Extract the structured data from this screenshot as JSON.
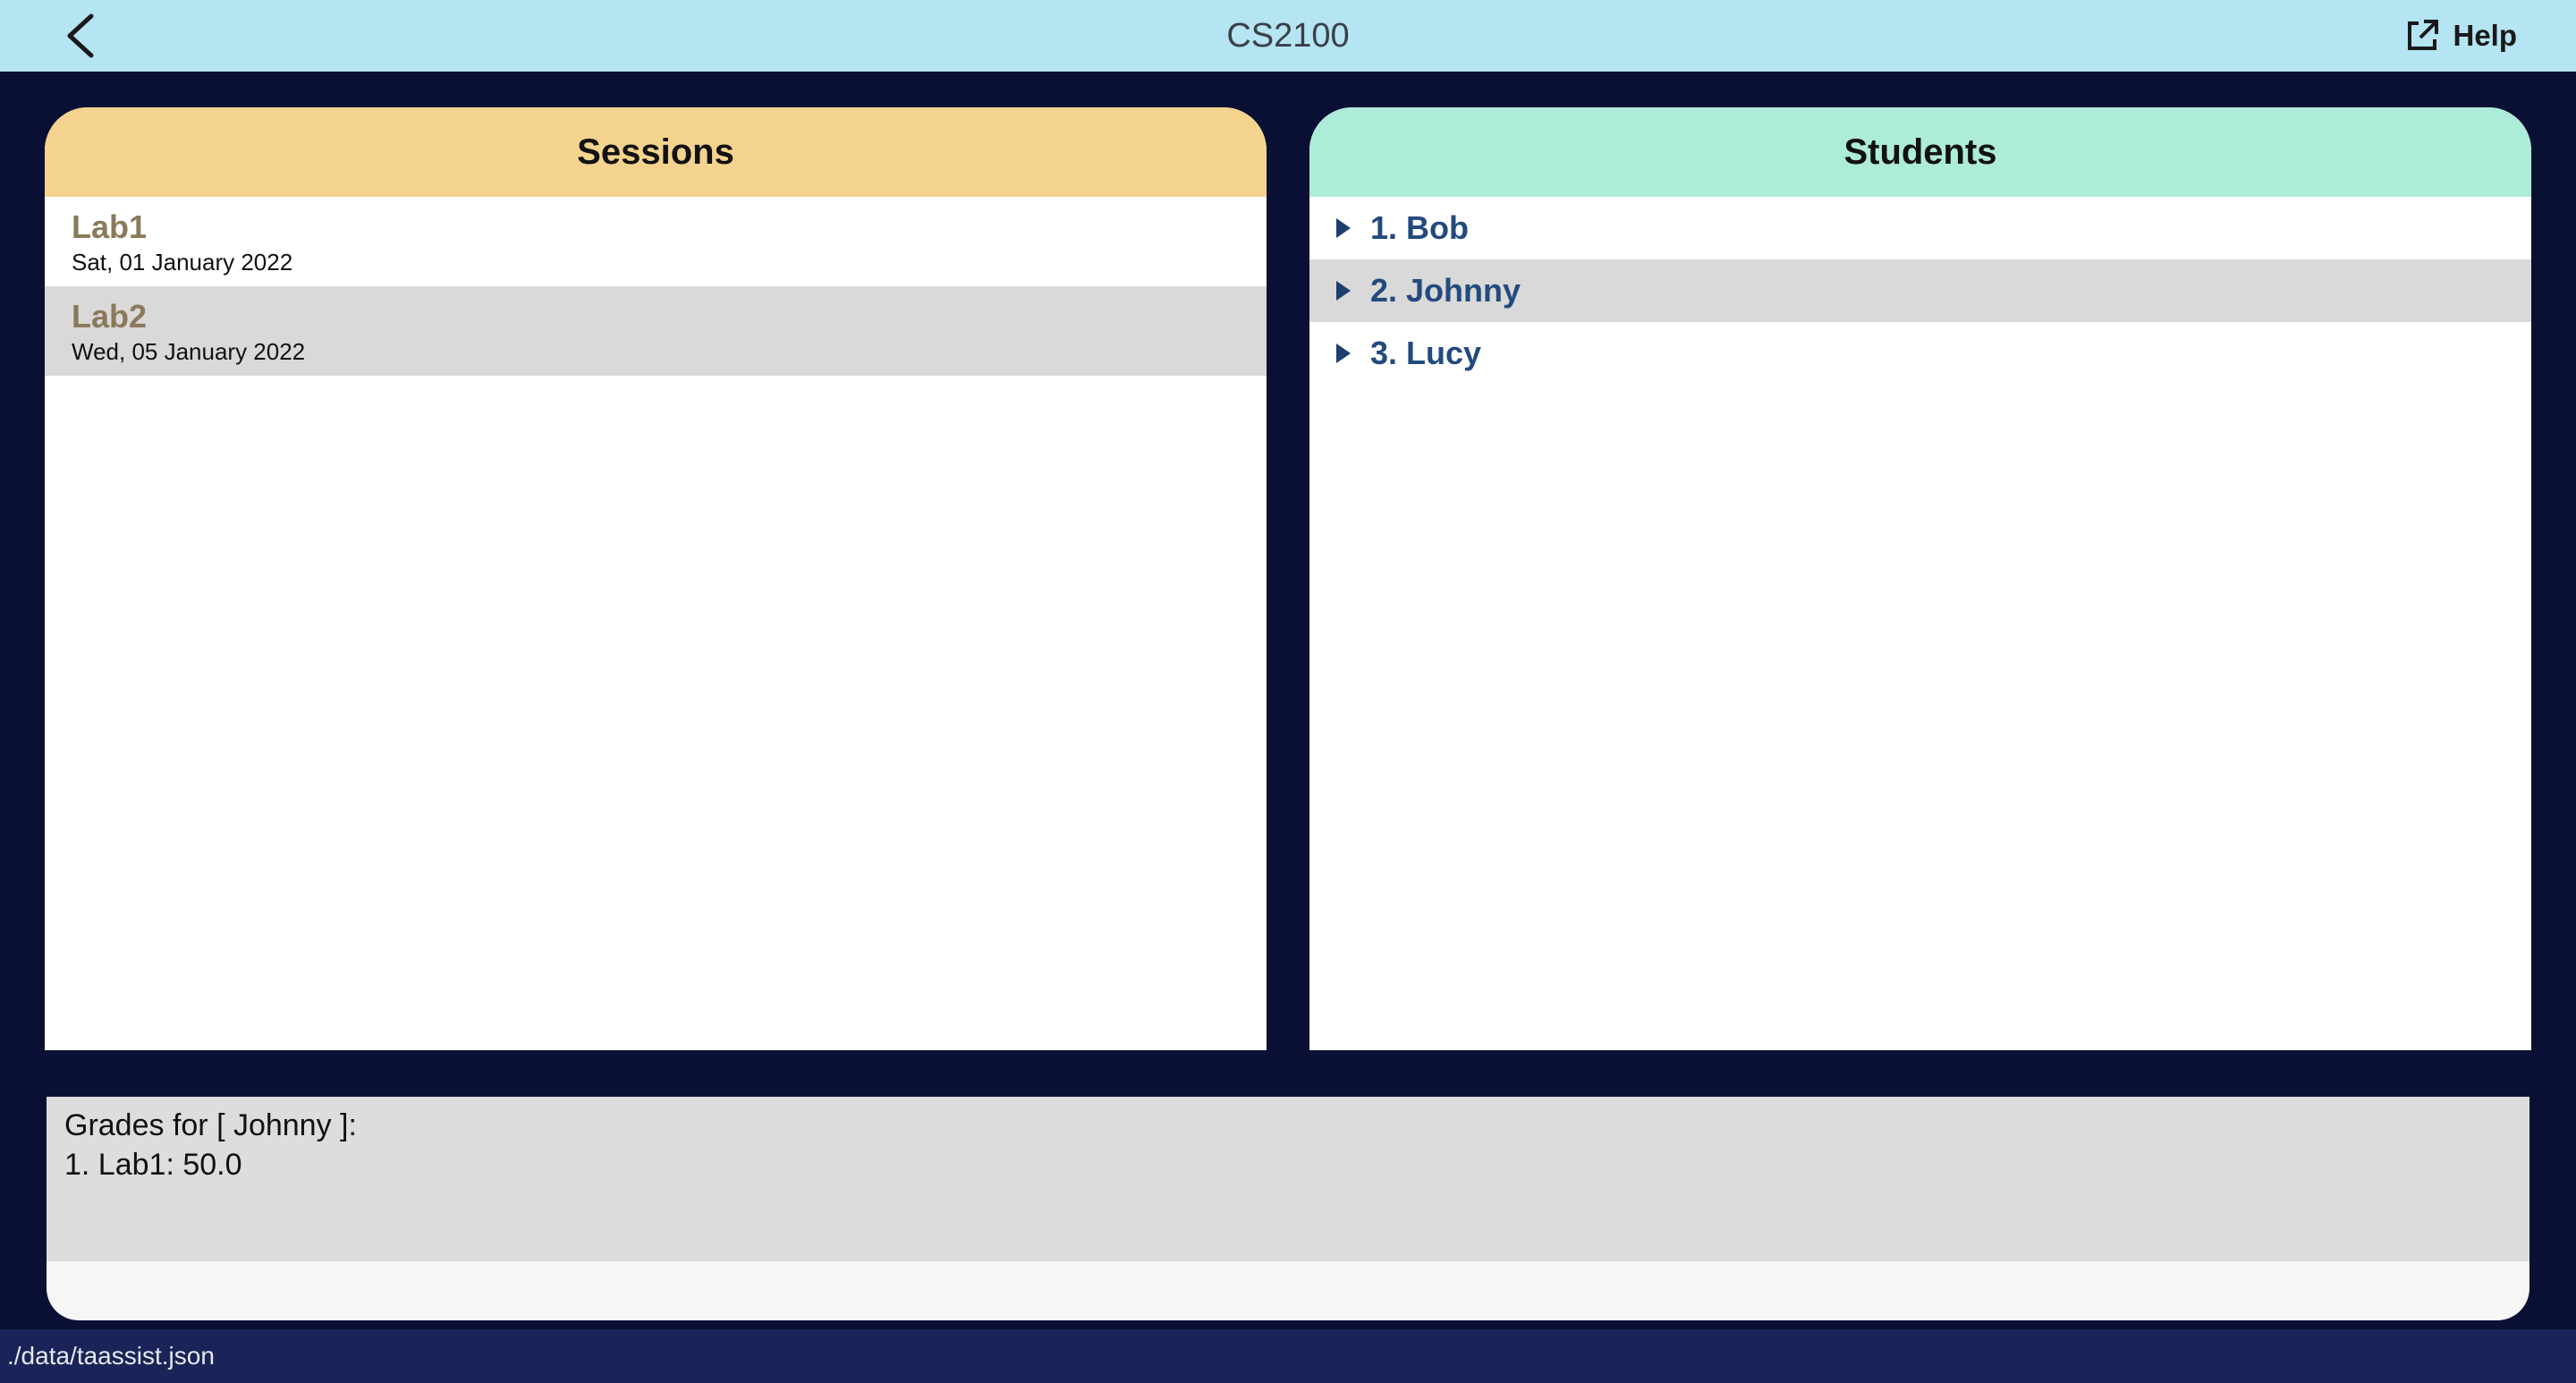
{
  "header": {
    "title": "CS2100",
    "back_icon": "chevron-left-icon",
    "help_label": "Help",
    "help_icon": "external-link-icon"
  },
  "sessions": {
    "title": "Sessions",
    "items": [
      {
        "name": "Lab1",
        "date": "Sat, 01 January 2022"
      },
      {
        "name": "Lab2",
        "date": "Wed, 05 January 2022"
      }
    ]
  },
  "students": {
    "title": "Students",
    "items": [
      {
        "label": "1. Bob"
      },
      {
        "label": "2. Johnny"
      },
      {
        "label": "3. Lucy"
      }
    ]
  },
  "result": {
    "line1": "Grades for [ Johnny ]:",
    "line2": "1. Lab1: 50.0"
  },
  "status": {
    "file_path": "./data/taassist.json"
  },
  "colors": {
    "topbar": "#b5e4f2",
    "background": "#0a1033",
    "sessions_header": "#f4d38e",
    "students_header": "#acecd9",
    "session_name": "#8b7a5a",
    "student_name": "#234a7d"
  }
}
